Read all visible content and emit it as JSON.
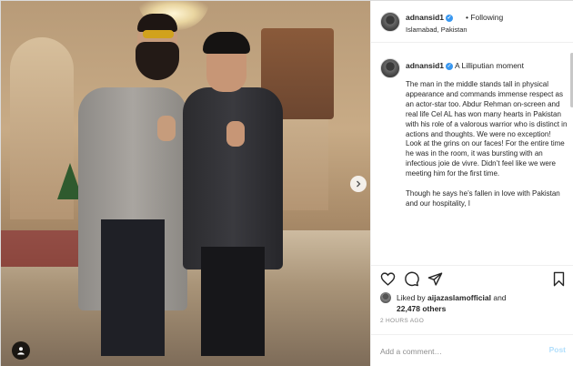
{
  "header": {
    "username": "adnansid1",
    "separator": "•",
    "follow_status": "Following",
    "location": "Islamabad, Pakistan"
  },
  "caption": {
    "username": "adnansid1",
    "title": "A Lilliputian moment",
    "body": "The man in the middle stands tall in physical appearance and commands immense respect as an actor-star too. Abdur Rehman on-screen and real life Cel AL has won many hearts in Pakistan with his role of a valorous warrior who is distinct in actions and thoughts. We were no exception! Look at the grins on our faces! For the entire time he was in the room, it was bursting with an infectious joie de vivre. Didn’t feel like we were meeting him for the first time.\n\nThough he says he’s fallen in love with Pakistan and our hospitality, I"
  },
  "likes": {
    "prefix": "Liked by",
    "user": "aijazaslamofficial",
    "joiner": "and",
    "count": "22,478 others"
  },
  "timestamp": "2 HOURS AGO",
  "comment_box": {
    "placeholder": "Add a comment…",
    "post_label": "Post"
  },
  "icons": {
    "verified": "verified-badge-icon",
    "like": "heart-icon",
    "comment": "comment-icon",
    "share": "share-icon",
    "save": "bookmark-icon",
    "next": "chevron-right-icon",
    "tag": "user-tag-icon"
  },
  "colors": {
    "verified": "#3897f0",
    "post_button": "#b2dffc",
    "muted": "#8e8e8e",
    "text": "#262626"
  }
}
